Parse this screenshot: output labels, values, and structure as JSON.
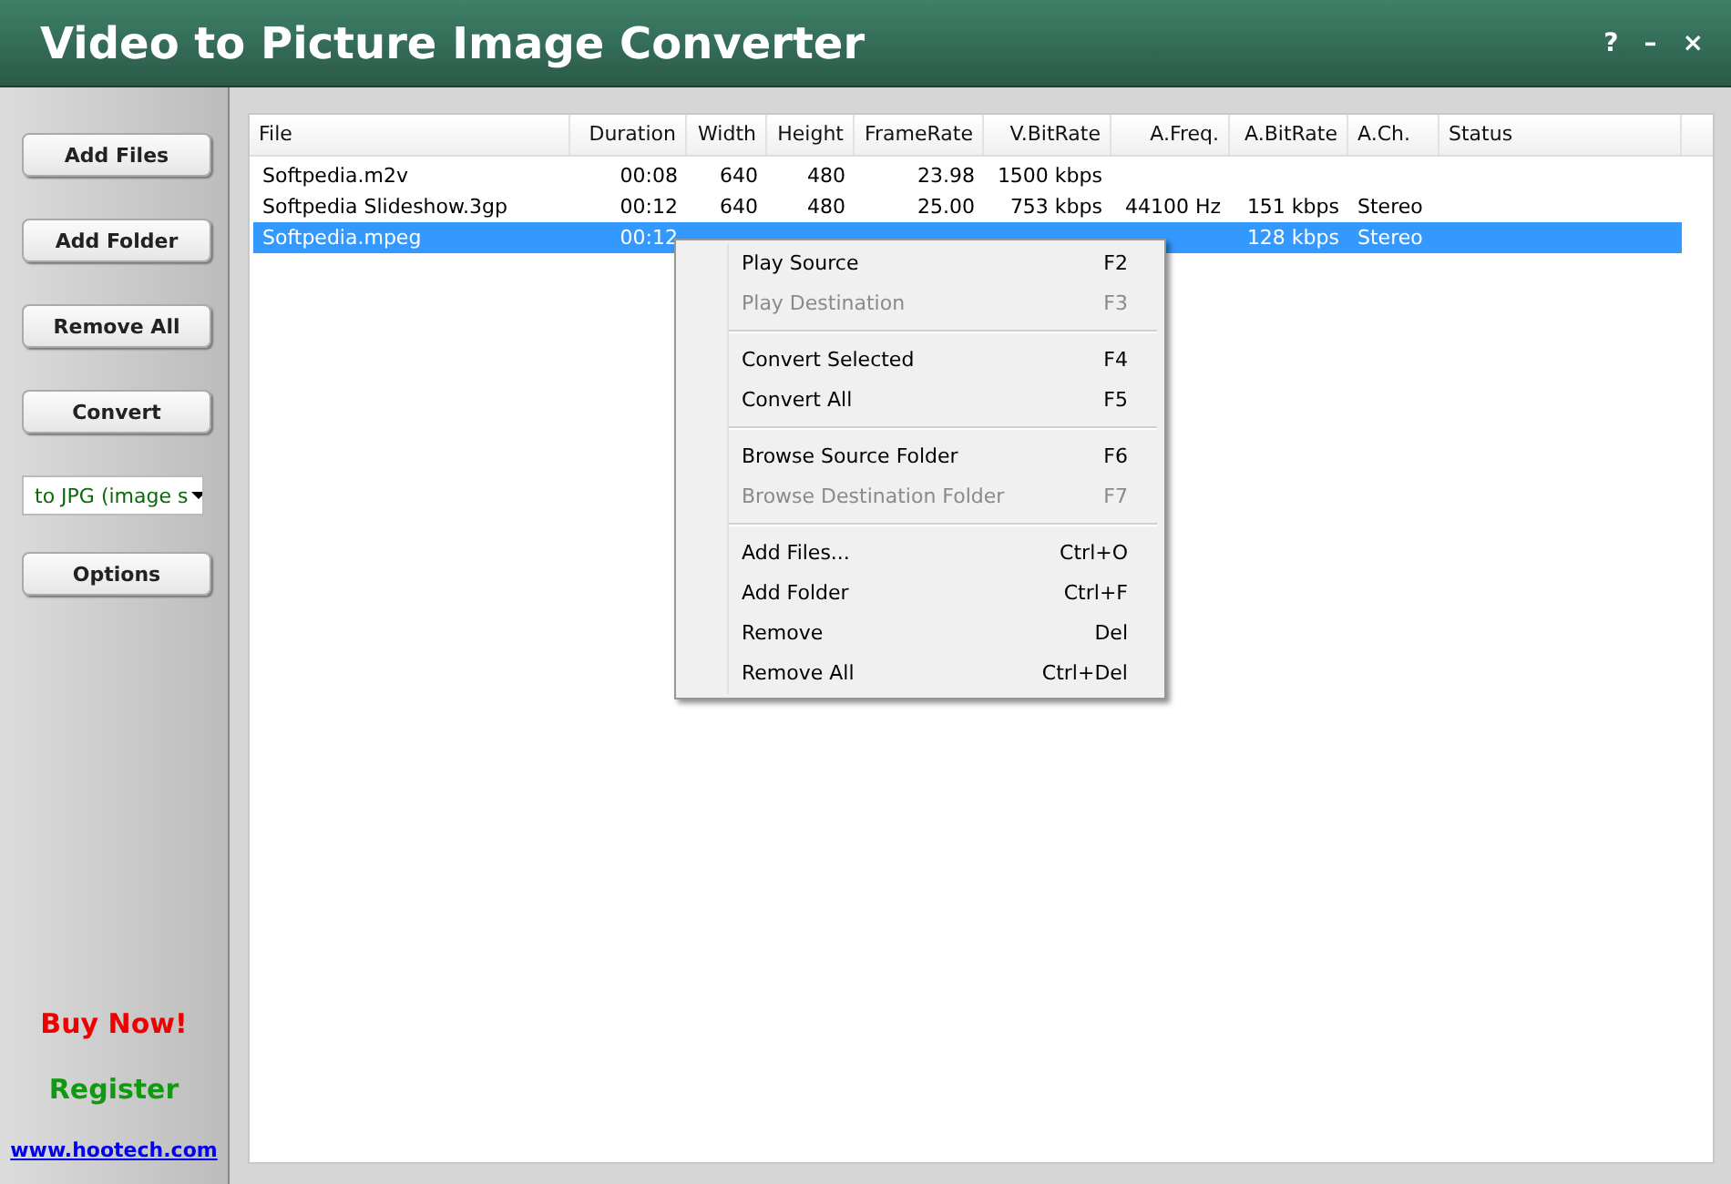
{
  "window": {
    "title": "Video to Picture Image Converter",
    "controls": [
      "?",
      "–",
      "×"
    ]
  },
  "sidebar": {
    "buttons": [
      {
        "kind": "button",
        "label": "Add Files"
      },
      {
        "kind": "button",
        "label": "Add Folder"
      },
      {
        "kind": "button",
        "label": "Remove All"
      },
      {
        "kind": "button",
        "label": "Convert"
      },
      {
        "kind": "dropdown",
        "label": "to JPG (image s"
      },
      {
        "kind": "button",
        "label": "Options"
      }
    ],
    "links": [
      {
        "kind": "buy",
        "label": "Buy Now!"
      },
      {
        "kind": "register",
        "label": "Register"
      },
      {
        "kind": "url",
        "label": "www.hootech.com"
      }
    ]
  },
  "table": {
    "columns": [
      "File",
      "Duration",
      "Width",
      "Height",
      "FrameRate",
      "V.BitRate",
      "A.Freq.",
      "A.BitRate",
      "A.Ch.",
      "Status"
    ],
    "rows": [
      {
        "selected": false,
        "cells": [
          "Softpedia.m2v",
          "00:08",
          "640",
          "480",
          "23.98",
          "1500 kbps",
          null,
          null,
          null,
          null
        ]
      },
      {
        "selected": false,
        "cells": [
          "Softpedia Slideshow.3gp",
          "00:12",
          "640",
          "480",
          "25.00",
          "753 kbps",
          "44100 Hz",
          "151 kbps",
          "Stereo",
          null
        ]
      },
      {
        "selected": true,
        "cells": [
          "Softpedia.mpeg",
          "00:12",
          null,
          null,
          null,
          null,
          null,
          "128 kbps",
          "Stereo",
          null
        ]
      }
    ]
  },
  "context_menu": {
    "groups": [
      [
        {
          "label": "Play Source",
          "shortcut": "F2",
          "disabled": false
        },
        {
          "label": "Play Destination",
          "shortcut": "F3",
          "disabled": true
        }
      ],
      [
        {
          "label": "Convert Selected",
          "shortcut": "F4",
          "disabled": false
        },
        {
          "label": "Convert All",
          "shortcut": "F5",
          "disabled": false
        }
      ],
      [
        {
          "label": "Browse Source Folder",
          "shortcut": "F6",
          "disabled": false
        },
        {
          "label": "Browse Destination Folder",
          "shortcut": "F7",
          "disabled": true
        }
      ],
      [
        {
          "label": "Add Files...",
          "shortcut": "Ctrl+O",
          "disabled": false
        },
        {
          "label": "Add Folder",
          "shortcut": "Ctrl+F",
          "disabled": false
        },
        {
          "label": "Remove",
          "shortcut": "Del",
          "disabled": false
        },
        {
          "label": "Remove All",
          "shortcut": "Ctrl+Del",
          "disabled": false
        }
      ]
    ]
  }
}
